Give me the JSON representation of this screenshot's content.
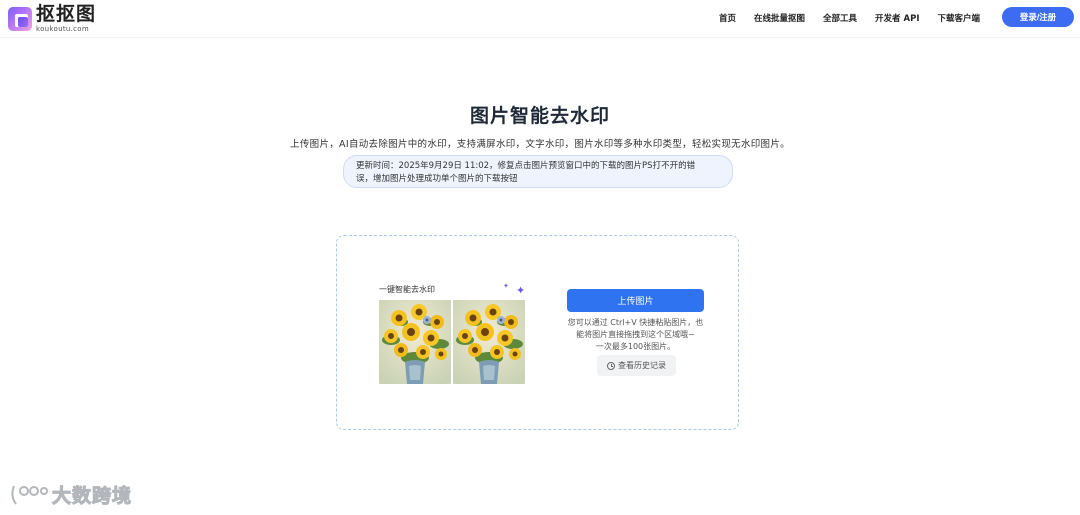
{
  "header": {
    "logo_cn": "抠抠图",
    "logo_en": "koukoutu.com",
    "nav": [
      "首页",
      "在线批量抠图",
      "全部工具",
      "开发者 API",
      "下载客户端"
    ],
    "login_label": "登录/注册"
  },
  "hero": {
    "title": "图片智能去水印",
    "subtitle": "上传图片，AI自动去除图片中的水印，支持满屏水印，文字水印，图片水印等多种水印类型，轻松实现无水印图片。",
    "update_line1": "更新时间：2025年9月29日 11:02，修复点击图片预览窗口中的下载的图片PS打不开的错",
    "update_line2": "误，增加图片处理成功单个图片的下载按钮"
  },
  "upload": {
    "demo_label": "一键智能去水印",
    "upload_label": "上传图片",
    "tip_line1": "您可以通过 Ctrl+V 快捷粘贴图片，也",
    "tip_line2": "能将图片直接拖拽到这个区域哦~",
    "tip_line3": "一次最多100张图片。",
    "history_label": "查看历史记录"
  },
  "watermark": {
    "text": "大数跨境"
  },
  "colors": {
    "primary": "#2f73f0",
    "login": "#3d6cf2",
    "update_bg": "#eef3fd",
    "dashed_border": "#a9cbee"
  }
}
